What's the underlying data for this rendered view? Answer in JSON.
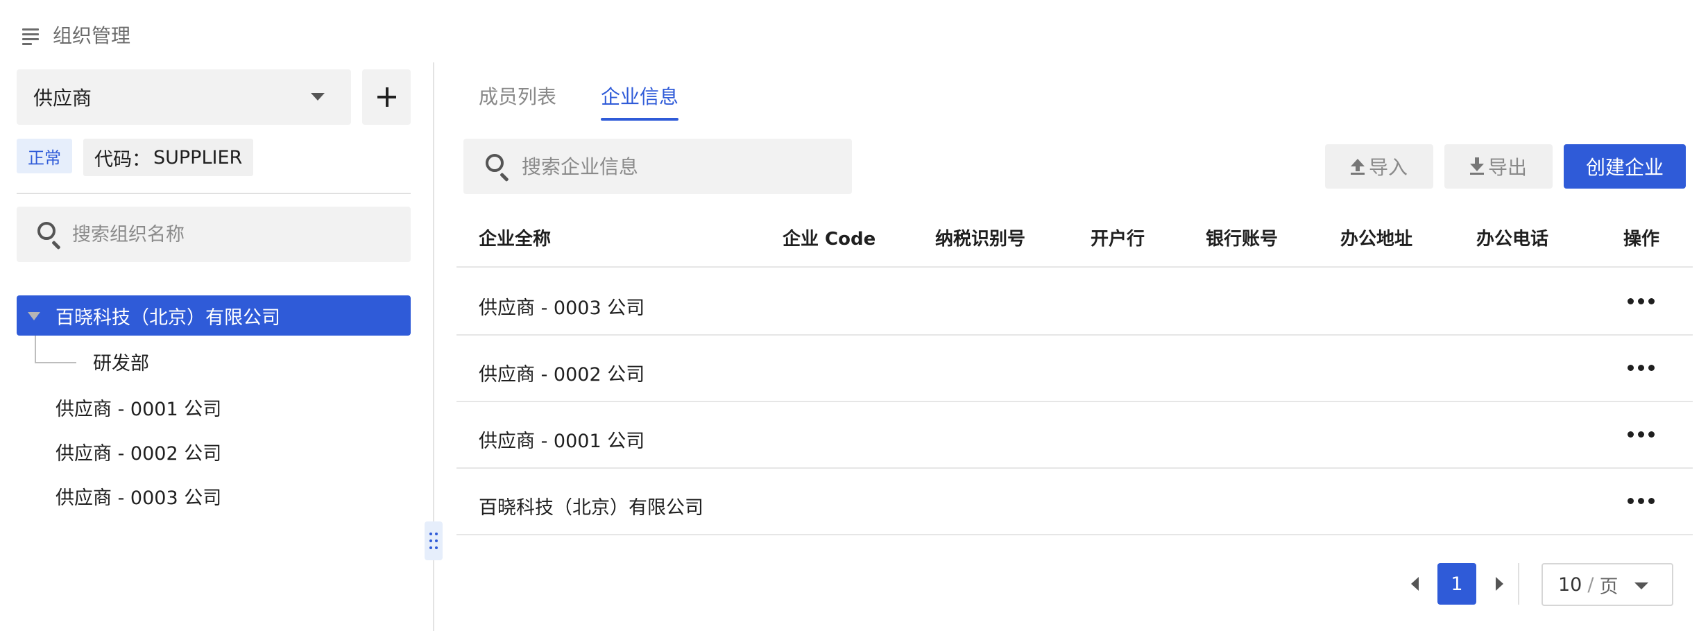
{
  "header": {
    "title": "组织管理",
    "icon": "menu-lines-icon"
  },
  "left_panel": {
    "org_select": {
      "value": "供应商"
    },
    "status_tag": "正常",
    "code_tag": {
      "label": "代码：",
      "value": "SUPPLIER"
    },
    "search": {
      "placeholder": "搜索组织名称"
    },
    "tree": {
      "root": "百晓科技（北京）有限公司",
      "root_children": [
        "研发部"
      ],
      "siblings": [
        "供应商 - 0001 公司",
        "供应商 - 0002 公司",
        "供应商 - 0003 公司"
      ]
    }
  },
  "right_panel": {
    "tabs": [
      {
        "label": "成员列表",
        "active": false
      },
      {
        "label": "企业信息",
        "active": true
      }
    ],
    "search": {
      "placeholder": "搜索企业信息"
    },
    "toolbar": {
      "import_label": "导入",
      "export_label": "导出",
      "create_label": "创建企业"
    },
    "table": {
      "columns": [
        "企业全称",
        "企业 Code",
        "纳税识别号",
        "开户行",
        "银行账号",
        "办公地址",
        "办公电话",
        "操作"
      ],
      "rows": [
        {
          "name": "供应商 - 0003 公司"
        },
        {
          "name": "供应商 - 0002 公司"
        },
        {
          "name": "供应商 - 0001 公司"
        },
        {
          "name": "百晓科技（北京）有限公司"
        }
      ]
    },
    "pagination": {
      "current_page": "1",
      "page_size": "10",
      "page_size_unit": "页",
      "separator": "/"
    }
  },
  "colors": {
    "accent": "#2f5bd8",
    "panel_bg": "#f2f2f2",
    "divider": "#e6e6e6"
  }
}
